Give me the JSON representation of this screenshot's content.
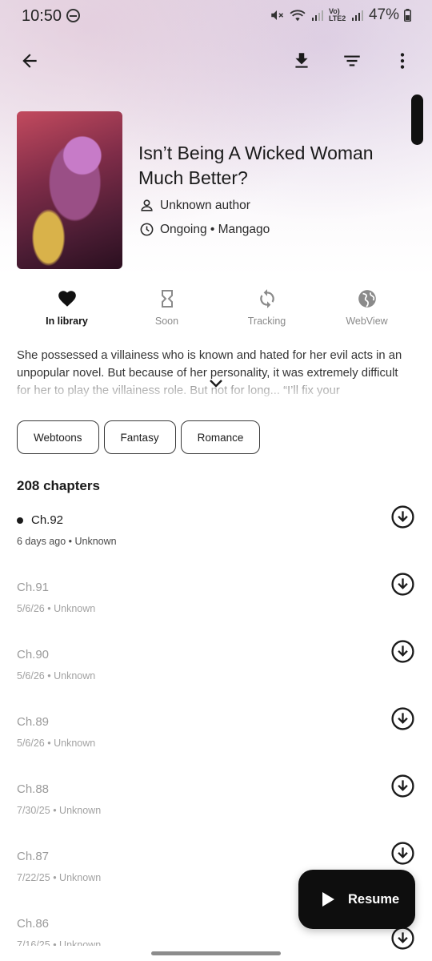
{
  "status_bar": {
    "time": "10:50",
    "network": "Vo) LTE2",
    "battery": "47%"
  },
  "manga": {
    "title": "Isn’t Being A Wicked Woman Much Better?",
    "author": "Unknown author",
    "status_source": "Ongoing • Mangago",
    "description": "She possessed a villainess who is known and hated for her evil acts in an unpopular novel. But because of her personality, it was extremely difficult for her to play the villainess role. But not for long... “I’ll fix your",
    "tags": [
      "Webtoons",
      "Fantasy",
      "Romance"
    ]
  },
  "actions": [
    {
      "label": "In library",
      "icon": "heart-icon",
      "active": true
    },
    {
      "label": "Soon",
      "icon": "hourglass-icon",
      "active": false
    },
    {
      "label": "Tracking",
      "icon": "sync-icon",
      "active": false
    },
    {
      "label": "WebView",
      "icon": "globe-icon",
      "active": false
    }
  ],
  "chapters_count": "208 chapters",
  "chapters": [
    {
      "name": "Ch.92",
      "date": "6 days ago",
      "scanlator": "Unknown",
      "unread": true
    },
    {
      "name": "Ch.91",
      "date": "5/6/26",
      "scanlator": "Unknown",
      "unread": false
    },
    {
      "name": "Ch.90",
      "date": "5/6/26",
      "scanlator": "Unknown",
      "unread": false
    },
    {
      "name": "Ch.89",
      "date": "5/6/26",
      "scanlator": "Unknown",
      "unread": false
    },
    {
      "name": "Ch.88",
      "date": "7/30/25",
      "scanlator": "Unknown",
      "unread": false
    },
    {
      "name": "Ch.87",
      "date": "7/22/25",
      "scanlator": "Unknown",
      "unread": false
    },
    {
      "name": "Ch.86",
      "date": "7/16/25",
      "scanlator": "Unknown",
      "unread": false
    }
  ],
  "resume_label": "Resume",
  "colors": {
    "fab": "#0e0e0e",
    "accent": "#1b1b1b",
    "muted": "#9a9a9a"
  }
}
